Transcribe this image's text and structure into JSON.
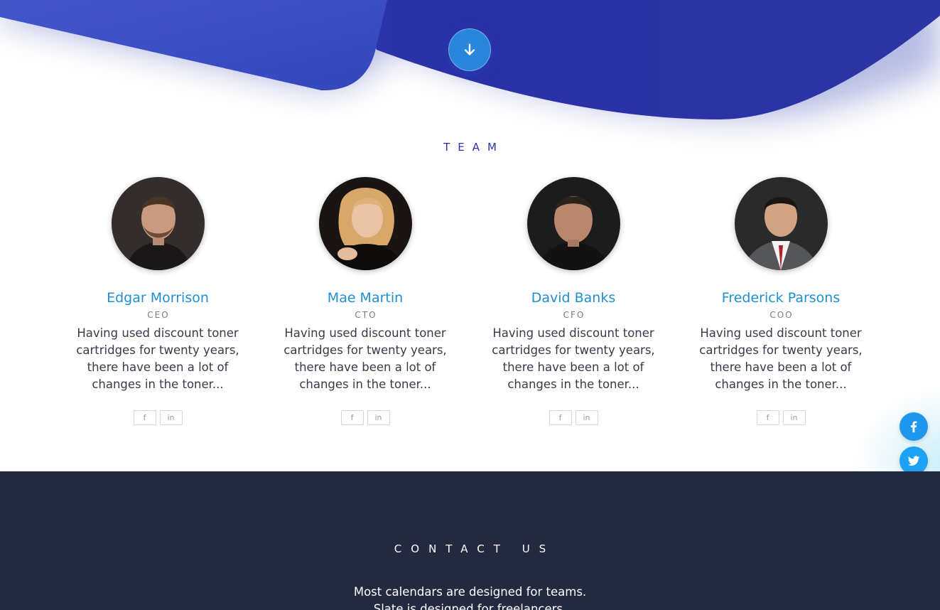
{
  "hero": {
    "scroll_icon": "arrow-down-icon",
    "colors": {
      "primary": "#2b33a8",
      "light": "#3a52c8",
      "button": "#2a86dc"
    }
  },
  "team": {
    "heading": "TEAM",
    "members": [
      {
        "name": "Edgar Morrison",
        "role": "CEO",
        "bio": "Having used discount toner cartridges for twenty years, there have been a lot of changes in the toner...",
        "socials": [
          "facebook-icon",
          "linkedin-icon"
        ]
      },
      {
        "name": "Mae Martin",
        "role": "CTO",
        "bio": "Having used discount toner cartridges for twenty years, there have been a lot of changes in the toner...",
        "socials": [
          "facebook-icon",
          "linkedin-icon"
        ]
      },
      {
        "name": "David Banks",
        "role": "CFO",
        "bio": "Having used discount toner cartridges for twenty years, there have been a lot of changes in the toner...",
        "socials": [
          "facebook-icon",
          "linkedin-icon"
        ]
      },
      {
        "name": "Frederick Parsons",
        "role": "COO",
        "bio": "Having used discount toner cartridges for twenty years, there have been a lot of changes in the toner...",
        "socials": [
          "facebook-icon",
          "linkedin-icon"
        ]
      }
    ],
    "colors": {
      "name": "#1f8fd2",
      "heading": "#2a35a8"
    }
  },
  "share": {
    "buttons": [
      "facebook-icon",
      "twitter-icon"
    ],
    "colors": {
      "facebook": "#1e97ee",
      "twitter": "#1da1f2"
    }
  },
  "contact": {
    "heading": "CONTACT US",
    "line1": "Most calendars are designed for teams.",
    "line2": "Slate is designed for freelancers.",
    "colors": {
      "background": "#232a3f"
    }
  }
}
